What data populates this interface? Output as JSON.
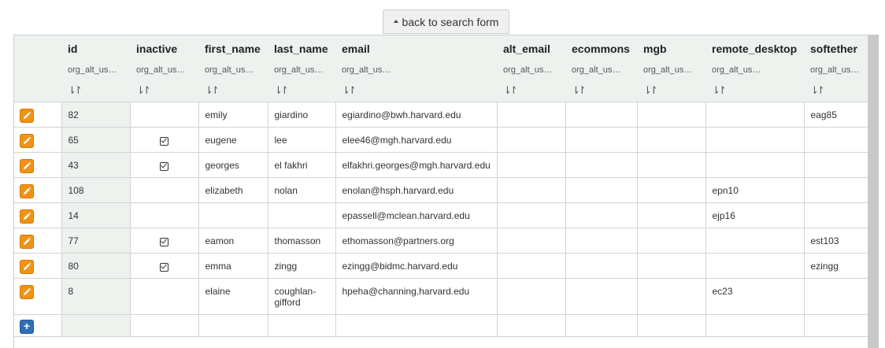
{
  "back_button": {
    "label": "back to search form"
  },
  "columns": [
    {
      "name": "id",
      "sub": "org_alt_us…"
    },
    {
      "name": "inactive",
      "sub": "org_alt_us…"
    },
    {
      "name": "first_name",
      "sub": "org_alt_us…"
    },
    {
      "name": "last_name",
      "sub": "org_alt_us…"
    },
    {
      "name": "email",
      "sub": "org_alt_us…"
    },
    {
      "name": "alt_email",
      "sub": "org_alt_us…"
    },
    {
      "name": "ecommons",
      "sub": "org_alt_us…"
    },
    {
      "name": "mgb",
      "sub": "org_alt_us…"
    },
    {
      "name": "remote_desktop",
      "sub": "org_alt_us…"
    },
    {
      "name": "softether",
      "sub": "org_alt_us…"
    }
  ],
  "sort_icon": "⇂↾",
  "rows": [
    {
      "id": "82",
      "inactive": false,
      "first_name": "emily",
      "last_name": "giardino",
      "email": "egiardino@bwh.harvard.edu",
      "alt_email": "",
      "ecommons": "",
      "mgb": "",
      "remote_desktop": "",
      "softether": "eag85"
    },
    {
      "id": "65",
      "inactive": true,
      "first_name": "eugene",
      "last_name": "lee",
      "email": "elee46@mgh.harvard.edu",
      "alt_email": "",
      "ecommons": "",
      "mgb": "",
      "remote_desktop": "",
      "softether": ""
    },
    {
      "id": "43",
      "inactive": true,
      "first_name": "georges",
      "last_name": "el fakhri",
      "email": "elfakhri.georges@mgh.harvard.edu",
      "alt_email": "",
      "ecommons": "",
      "mgb": "",
      "remote_desktop": "",
      "softether": ""
    },
    {
      "id": "108",
      "inactive": false,
      "first_name": "elizabeth",
      "last_name": "nolan",
      "email": "enolan@hsph.harvard.edu",
      "alt_email": "",
      "ecommons": "",
      "mgb": "",
      "remote_desktop": "epn10",
      "softether": ""
    },
    {
      "id": "14",
      "inactive": false,
      "first_name": "",
      "last_name": "",
      "email": "epassell@mclean.harvard.edu",
      "alt_email": "",
      "ecommons": "",
      "mgb": "",
      "remote_desktop": "ejp16",
      "softether": ""
    },
    {
      "id": "77",
      "inactive": true,
      "first_name": "eamon",
      "last_name": "thomasson",
      "email": "ethomasson@partners.org",
      "alt_email": "",
      "ecommons": "",
      "mgb": "",
      "remote_desktop": "",
      "softether": "est103"
    },
    {
      "id": "80",
      "inactive": true,
      "first_name": "emma",
      "last_name": "zingg",
      "email": "ezingg@bidmc.harvard.edu",
      "alt_email": "",
      "ecommons": "",
      "mgb": "",
      "remote_desktop": "",
      "softether": "ezingg"
    },
    {
      "id": "8",
      "inactive": false,
      "first_name": "elaine",
      "last_name": "coughlan-gifford",
      "email": "hpeha@channing.harvard.edu",
      "alt_email": "",
      "ecommons": "",
      "mgb": "",
      "remote_desktop": "ec23",
      "softether": ""
    }
  ],
  "add_row_label": "+",
  "colors": {
    "header_bg": "#edf2ee",
    "edit_button": "#f09216",
    "add_button": "#2f6fb3"
  }
}
